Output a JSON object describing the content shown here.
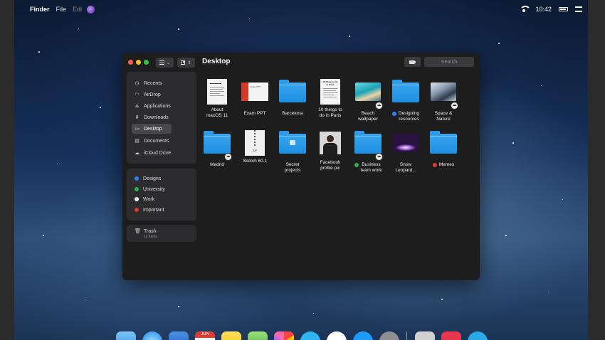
{
  "menubar": {
    "app": "Finder",
    "items": [
      "File",
      "Edi"
    ],
    "time": "10:42"
  },
  "window": {
    "title": "Desktop",
    "search_placeholder": "Search"
  },
  "sidebar": {
    "favorites": [
      {
        "label": "Recents",
        "icon": "clock-icon"
      },
      {
        "label": "AirDrop",
        "icon": "airdrop-icon"
      },
      {
        "label": "Applications",
        "icon": "applications-icon"
      },
      {
        "label": "Downloads",
        "icon": "downloads-icon"
      },
      {
        "label": "Desktop",
        "icon": "desktop-icon"
      },
      {
        "label": "Documents",
        "icon": "documents-icon"
      },
      {
        "label": "iCloud Drive",
        "icon": "cloud-icon"
      }
    ],
    "tags": [
      {
        "label": "Designs",
        "color": "#2f7cf6"
      },
      {
        "label": "University",
        "color": "#28b34a"
      },
      {
        "label": "Work",
        "color": "#ffffff"
      },
      {
        "label": "Important",
        "color": "#e0382e"
      }
    ],
    "trash": {
      "label": "Trash",
      "count": "12 items"
    }
  },
  "files": [
    {
      "line1": "About",
      "line2": "macOS 11",
      "kind": "doc"
    },
    {
      "line1": "Exam PPT",
      "line2": "",
      "kind": "ppt"
    },
    {
      "line1": "Barcelona",
      "line2": "",
      "kind": "folder"
    },
    {
      "line1": "10 things to",
      "line2": "do in Paris",
      "kind": "doc"
    },
    {
      "line1": "Beach",
      "line2": "wallpaper",
      "kind": "beach",
      "cloud": true
    },
    {
      "line1": "Designing",
      "line2": "resources",
      "kind": "folder",
      "tag": "#2f7cf6"
    },
    {
      "line1": "Space &",
      "line2": "Nature",
      "kind": "space",
      "cloud": true
    },
    {
      "line1": "Madrid",
      "line2": "",
      "kind": "folder",
      "cloud": true
    },
    {
      "line1": "Sketch 60.1",
      "line2": "",
      "kind": "zip"
    },
    {
      "line1": "Secret",
      "line2": "projects",
      "kind": "folder-lock"
    },
    {
      "line1": "Facebook",
      "line2": "profile pic",
      "kind": "photo"
    },
    {
      "line1": "Business",
      "line2": "team work",
      "kind": "folder",
      "tag": "#28b34a",
      "cloud": true
    },
    {
      "line1": "Snow",
      "line2": "Leopard...",
      "kind": "leopard"
    },
    {
      "line1": "Memes",
      "line2": "",
      "kind": "folder",
      "tag": "#e0382e"
    }
  ],
  "file_extras": {
    "ppt_title": "Exam PPT",
    "zip_label": "ZIP",
    "doc_heading": "10 things to do in Paris"
  },
  "dock": {
    "calendar_month": "JUN"
  }
}
